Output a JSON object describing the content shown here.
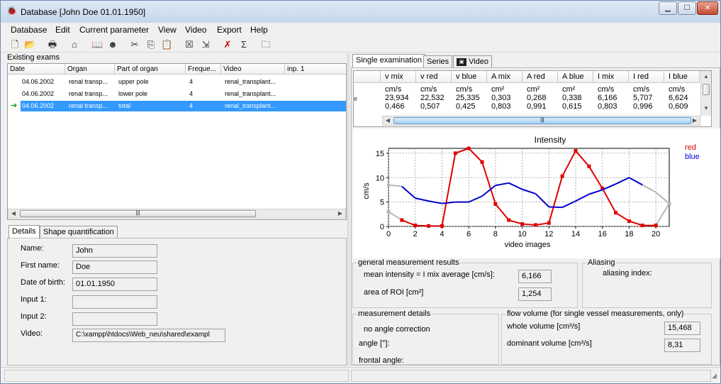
{
  "window": {
    "title": "Database [John Doe 01.01.1950]",
    "min": "▁",
    "max": "☐",
    "close": "✕"
  },
  "menu": [
    "Database",
    "Edit",
    "Current parameter",
    "View",
    "Video",
    "Export",
    "Help"
  ],
  "toolbar": [
    "new-icon",
    "open-icon",
    "print-icon",
    "tool-icon",
    "book-icon",
    "user-icon",
    "cut-icon",
    "copy-icon",
    "paste-icon",
    "delete-box-icon",
    "export-icon",
    "cancel-icon",
    "sum-icon",
    "folder-icon"
  ],
  "exams": {
    "label": "Existing exams",
    "columns": [
      "Date",
      "Organ",
      "Part of organ",
      "Freque...",
      "Video",
      "inp. 1"
    ],
    "rows": [
      {
        "date": "04.06.2002",
        "organ": "renal transp...",
        "part": "upper pole",
        "freq": "4",
        "video": "renal_transplant..."
      },
      {
        "date": "04.06.2002",
        "organ": "renal transp...",
        "part": "lower pole",
        "freq": "4",
        "video": "renal_transplant..."
      },
      {
        "date": "04.06.2002",
        "organ": "renal transp...",
        "part": "total",
        "freq": "4",
        "video": "renal_transplant..."
      }
    ]
  },
  "left_tabs": [
    "Details",
    "Shape quantification"
  ],
  "details": {
    "name_label": "Name:",
    "name": "John",
    "first_label": "First name:",
    "first": "Doe",
    "dob_label": "Date of birth:",
    "dob": "01.01.1950",
    "in1_label": "Input 1:",
    "in1": "",
    "in2_label": "Input 2:",
    "in2": "",
    "video_label": "Video:",
    "video": "C:\\xampp\\htdocs\\Web_neu\\shared\\exampl"
  },
  "right_tabs": [
    "Single examination",
    "Series",
    "Video"
  ],
  "results": {
    "columns": [
      "v mix",
      "v red",
      "v blue",
      "A mix",
      "A red",
      "A blue",
      "I mix",
      "I red",
      "I blue"
    ],
    "units": [
      "cm/s",
      "cm/s",
      "cm/s",
      "cm²",
      "cm²",
      "cm²",
      "cm/s",
      "cm/s",
      "cm/s"
    ],
    "row1": [
      "23,934",
      "22,532",
      "25,335",
      "0,303",
      "0,268",
      "0,338",
      "6,166",
      "5,707",
      "6,624"
    ],
    "row2": [
      "0,466",
      "0,507",
      "0,425",
      "0,803",
      "0,991",
      "0,615",
      "0,803",
      "0,996",
      "0,609"
    ],
    "edge_char": "e"
  },
  "general": {
    "title": "general measurement results",
    "mean_label": "mean intensity = I mix average [cm/s]:",
    "mean": "6,166",
    "roi_label": "area of ROI [cm²]",
    "roi": "1,254"
  },
  "aliasing": {
    "title": "Aliasing",
    "index_label": "aliasing index:"
  },
  "details_box": {
    "title": "measurement details",
    "angle_corr": "no angle correction",
    "angle": "angle [°]:",
    "frontal": "frontal angle:"
  },
  "flow": {
    "title": "flow volume (for single vessel measurements, only)",
    "whole_label": "whole volume [cm³/s]",
    "whole": "15,468",
    "dom_label": "dominant volume [cm³/s]",
    "dom": "8,31"
  },
  "colors": {
    "red": "#e00000",
    "blue": "#0000d0",
    "gray": "#b8b8b8",
    "select": "#3399ff"
  },
  "chart_data": {
    "type": "line",
    "title": "Intensity",
    "xlabel": "video images",
    "ylabel": "cm/s",
    "xlim": [
      0,
      21
    ],
    "ylim": [
      0,
      16
    ],
    "xticks": [
      0,
      2,
      4,
      6,
      8,
      10,
      12,
      14,
      16,
      18,
      20
    ],
    "yticks": [
      0,
      5,
      10,
      15
    ],
    "legend": "top-right",
    "series": [
      {
        "name": "red",
        "color": "#e00000",
        "x": [
          0,
          1,
          2,
          3,
          4,
          5,
          6,
          7,
          8,
          9,
          10,
          11,
          12,
          13,
          14,
          15,
          16,
          17,
          18,
          19,
          20,
          21
        ],
        "y": [
          3,
          1.3,
          0.2,
          0.1,
          0.1,
          15,
          16,
          13.2,
          4.6,
          1.3,
          0.5,
          0.3,
          0.7,
          10.3,
          15.5,
          12.3,
          7.8,
          2.8,
          1.1,
          0.2,
          0.2,
          4.7
        ],
        "active": [
          1,
          20
        ],
        "markers": true
      },
      {
        "name": "blue",
        "color": "#0000d0",
        "x": [
          0,
          1,
          2,
          3,
          4,
          5,
          6,
          7,
          8,
          9,
          10,
          11,
          12,
          13,
          14,
          15,
          16,
          17,
          18,
          19,
          20,
          21
        ],
        "y": [
          8.5,
          8.2,
          5.8,
          5.2,
          4.7,
          5,
          5,
          6.2,
          8.4,
          8.9,
          7.6,
          6.7,
          4,
          3.9,
          5.2,
          6.6,
          7.5,
          8.7,
          10,
          8.5,
          7,
          4.7
        ],
        "active": [
          1,
          19
        ],
        "markers": false
      }
    ],
    "grid": true
  }
}
